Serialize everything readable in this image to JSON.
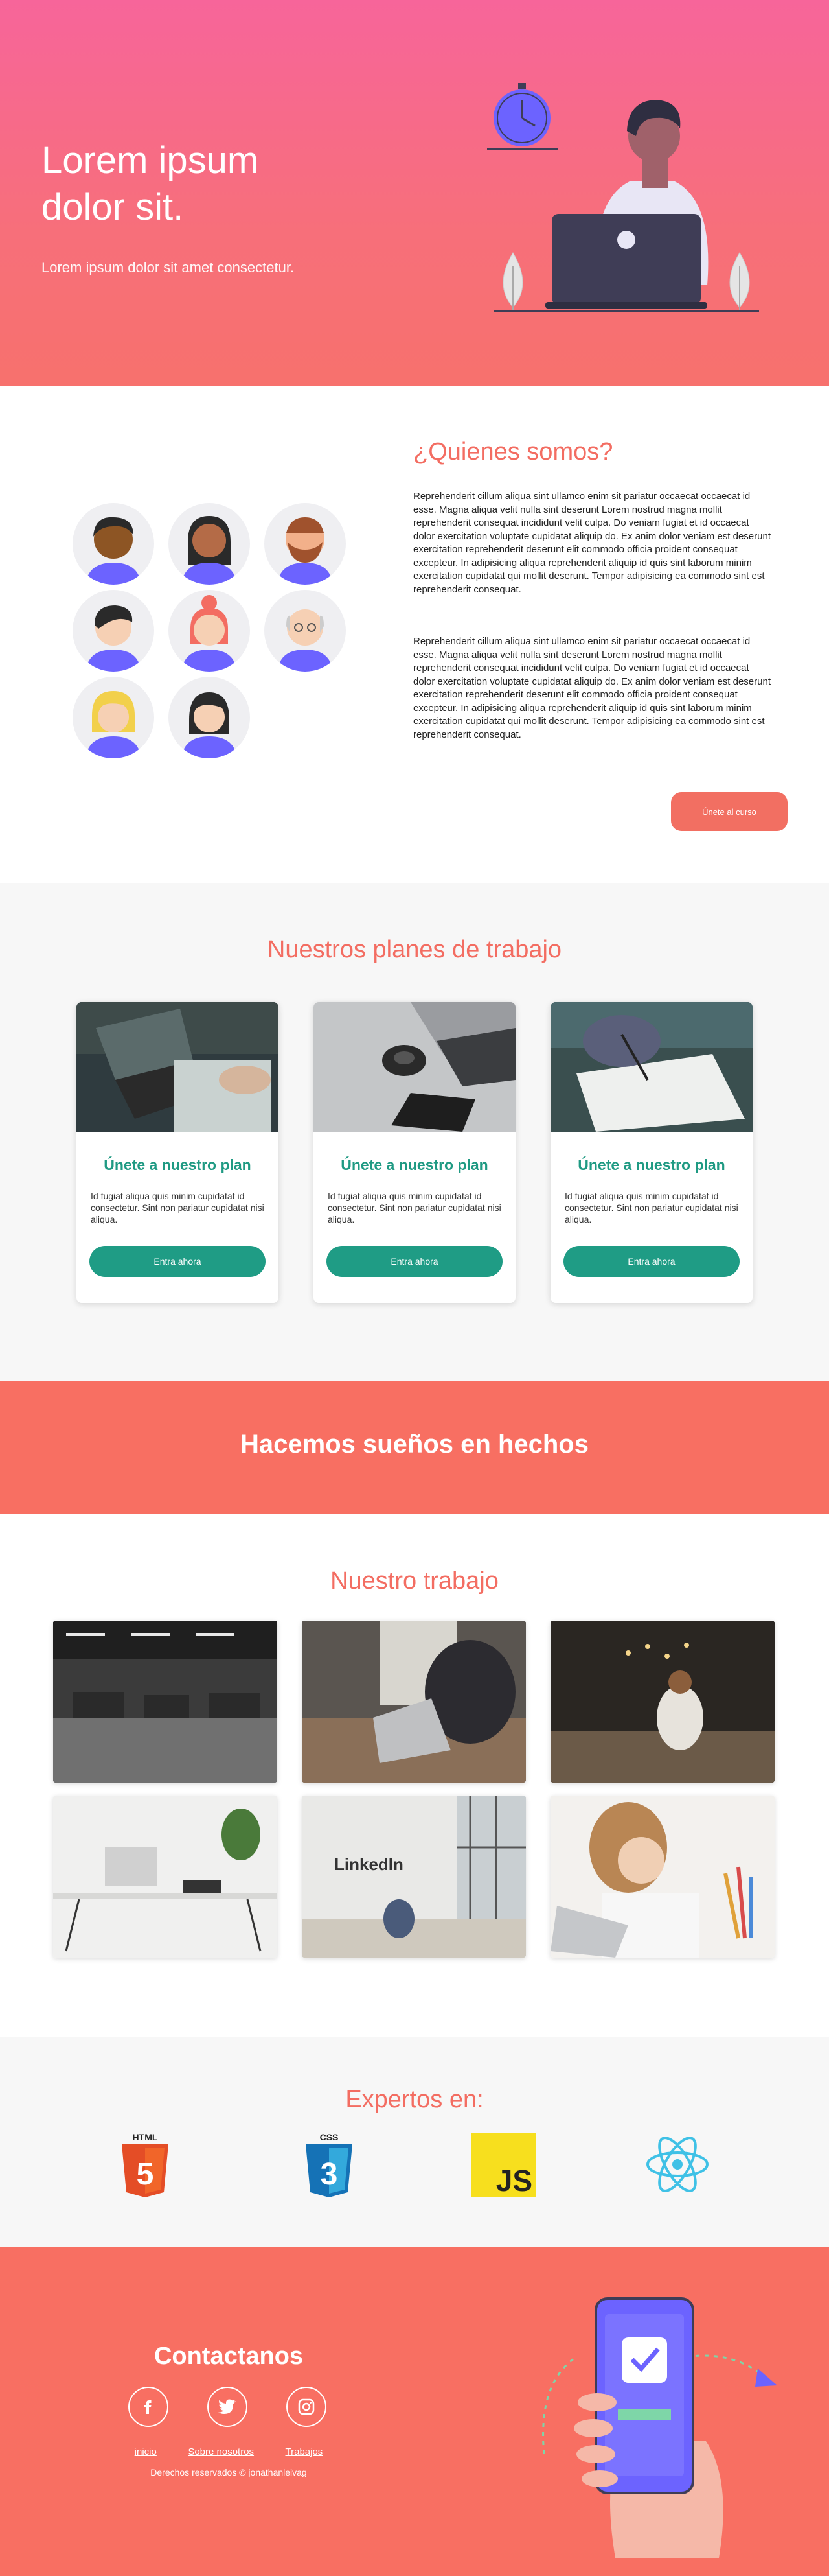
{
  "hero": {
    "title": "Lorem ipsum dolor sit.",
    "subtitle": "Lorem ipsum dolor sit amet consectetur."
  },
  "about": {
    "title": "¿Quienes somos?",
    "paragraph1": "Reprehenderit cillum aliqua sint ullamco enim sit pariatur occaecat occaecat id esse. Magna aliqua velit nulla sint deserunt Lorem nostrud magna mollit reprehenderit consequat incididunt velit culpa. Do veniam fugiat et id occaecat dolor exercitation voluptate cupidatat aliquip do. Ex anim dolor veniam est deserunt exercitation reprehenderit deserunt elit commodo officia proident consequat excepteur. In adipisicing aliqua reprehenderit aliquip id quis sint laborum minim exercitation cupidatat qui mollit deserunt. Tempor adipisicing ea commodo sint est reprehenderit consequat.",
    "paragraph2": "Reprehenderit cillum aliqua sint ullamco enim sit pariatur occaecat occaecat id esse. Magna aliqua velit nulla sint deserunt Lorem nostrud magna mollit reprehenderit consequat incididunt velit culpa. Do veniam fugiat et id occaecat dolor exercitation voluptate cupidatat aliquip do. Ex anim dolor veniam est deserunt exercitation reprehenderit deserunt elit commodo officia proident consequat excepteur. In adipisicing aliqua reprehenderit aliquip id quis sint laborum minim exercitation cupidatat qui mollit deserunt. Tempor adipisicing ea commodo sint est reprehenderit consequat.",
    "button": "Únete al curso"
  },
  "plans": {
    "title": "Nuestros planes de trabajo",
    "cards": [
      {
        "title": "Únete a nuestro plan",
        "text": "Id fugiat aliqua quis minim cupidatat id consectetur. Sint non pariatur cupidatat nisi aliqua.",
        "button": "Entra ahora"
      },
      {
        "title": "Únete a nuestro plan",
        "text": "Id fugiat aliqua quis minim cupidatat id consectetur. Sint non pariatur cupidatat nisi aliqua.",
        "button": "Entra ahora"
      },
      {
        "title": "Únete a nuestro plan",
        "text": "Id fugiat aliqua quis minim cupidatat id consectetur. Sint non pariatur cupidatat nisi aliqua.",
        "button": "Entra ahora"
      }
    ]
  },
  "banner": {
    "text": "Hacemos sueños en hechos"
  },
  "work": {
    "title": "Nuestro trabajo",
    "linkedin_sign": "LinkedIn"
  },
  "experts": {
    "title": "Expertos en:",
    "logos": [
      "HTML",
      "CSS",
      "JS"
    ]
  },
  "footer": {
    "title": "Contactanos",
    "links": [
      "inicio",
      "Sobre nosotros",
      "Trabajos"
    ],
    "copyright": "Derechos reservados © jonathanleivag"
  },
  "colors": {
    "accent": "#f36d62",
    "teal": "#1f9c85",
    "purple": "#6c63ff"
  }
}
